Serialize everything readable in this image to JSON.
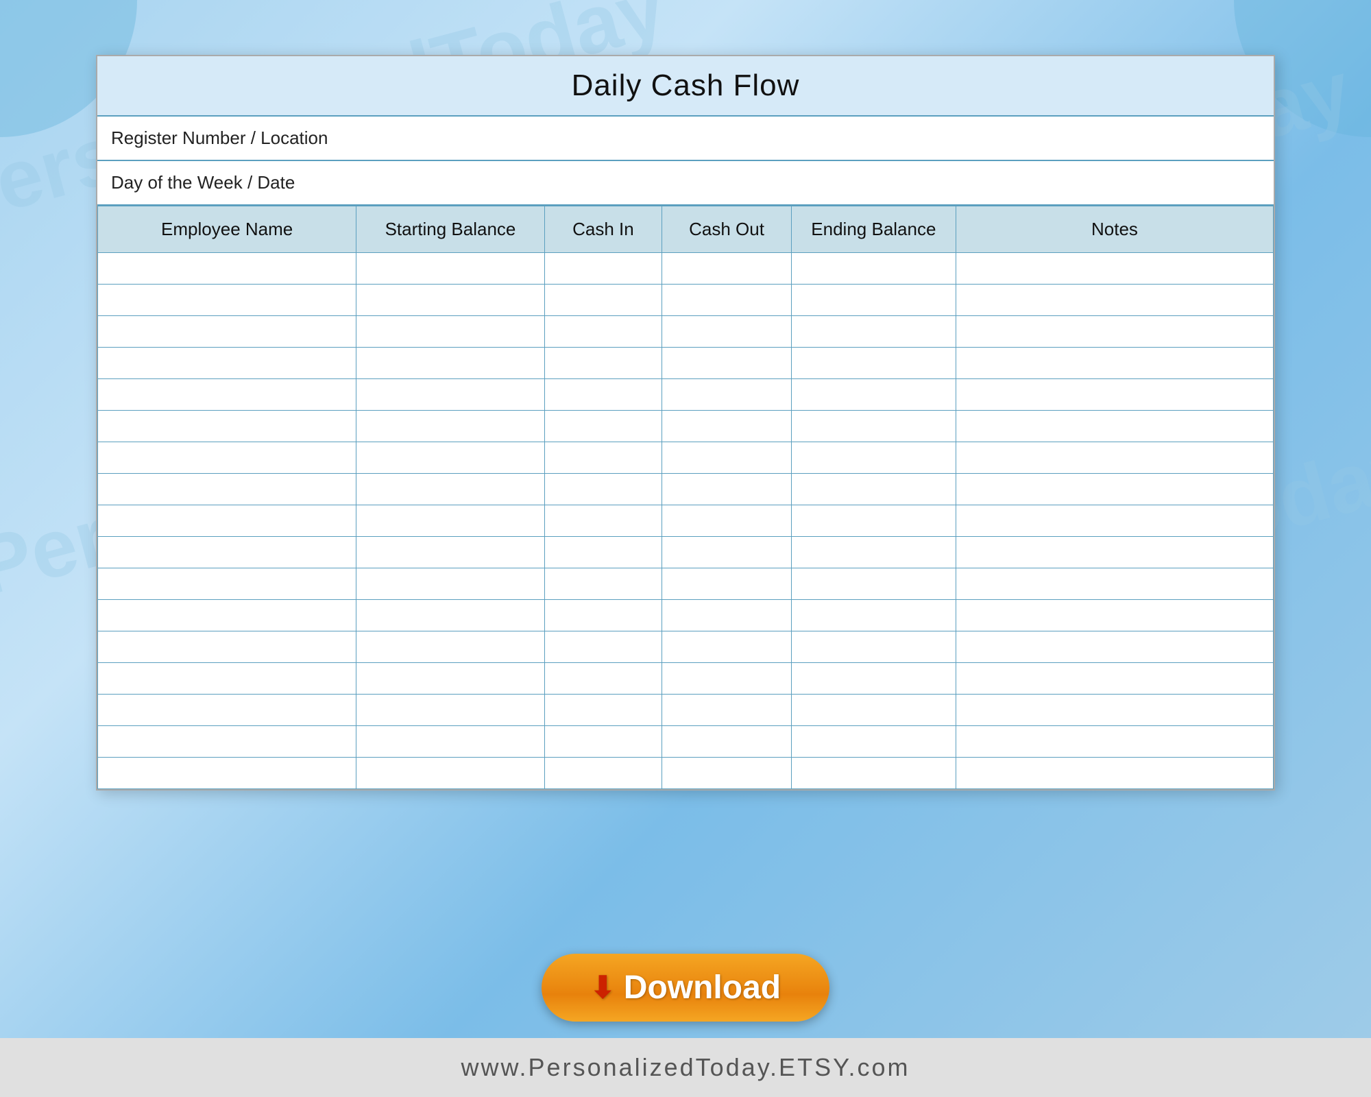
{
  "page": {
    "background_colors": [
      "#a8d4f0",
      "#c5e3f7",
      "#7bbde8"
    ],
    "footer_url": "www.PersonalizedToday.ETSY.com"
  },
  "document": {
    "title": "Daily Cash Flow",
    "register_label": "Register Number / Location",
    "day_label": "Day of the Week / Date",
    "table": {
      "columns": [
        {
          "key": "employee_name",
          "label": "Employee Name"
        },
        {
          "key": "starting_balance",
          "label": "Starting Balance"
        },
        {
          "key": "cash_in",
          "label": "Cash In"
        },
        {
          "key": "cash_out",
          "label": "Cash Out"
        },
        {
          "key": "ending_balance",
          "label": "Ending Balance"
        },
        {
          "key": "notes",
          "label": "Notes"
        }
      ],
      "row_count": 17
    }
  },
  "download_button": {
    "label": "Download",
    "arrow": "⬇"
  },
  "watermark": {
    "texts": [
      "PersonalizedToday",
      "PersonalizedToday",
      "PersonalizedToday"
    ]
  }
}
